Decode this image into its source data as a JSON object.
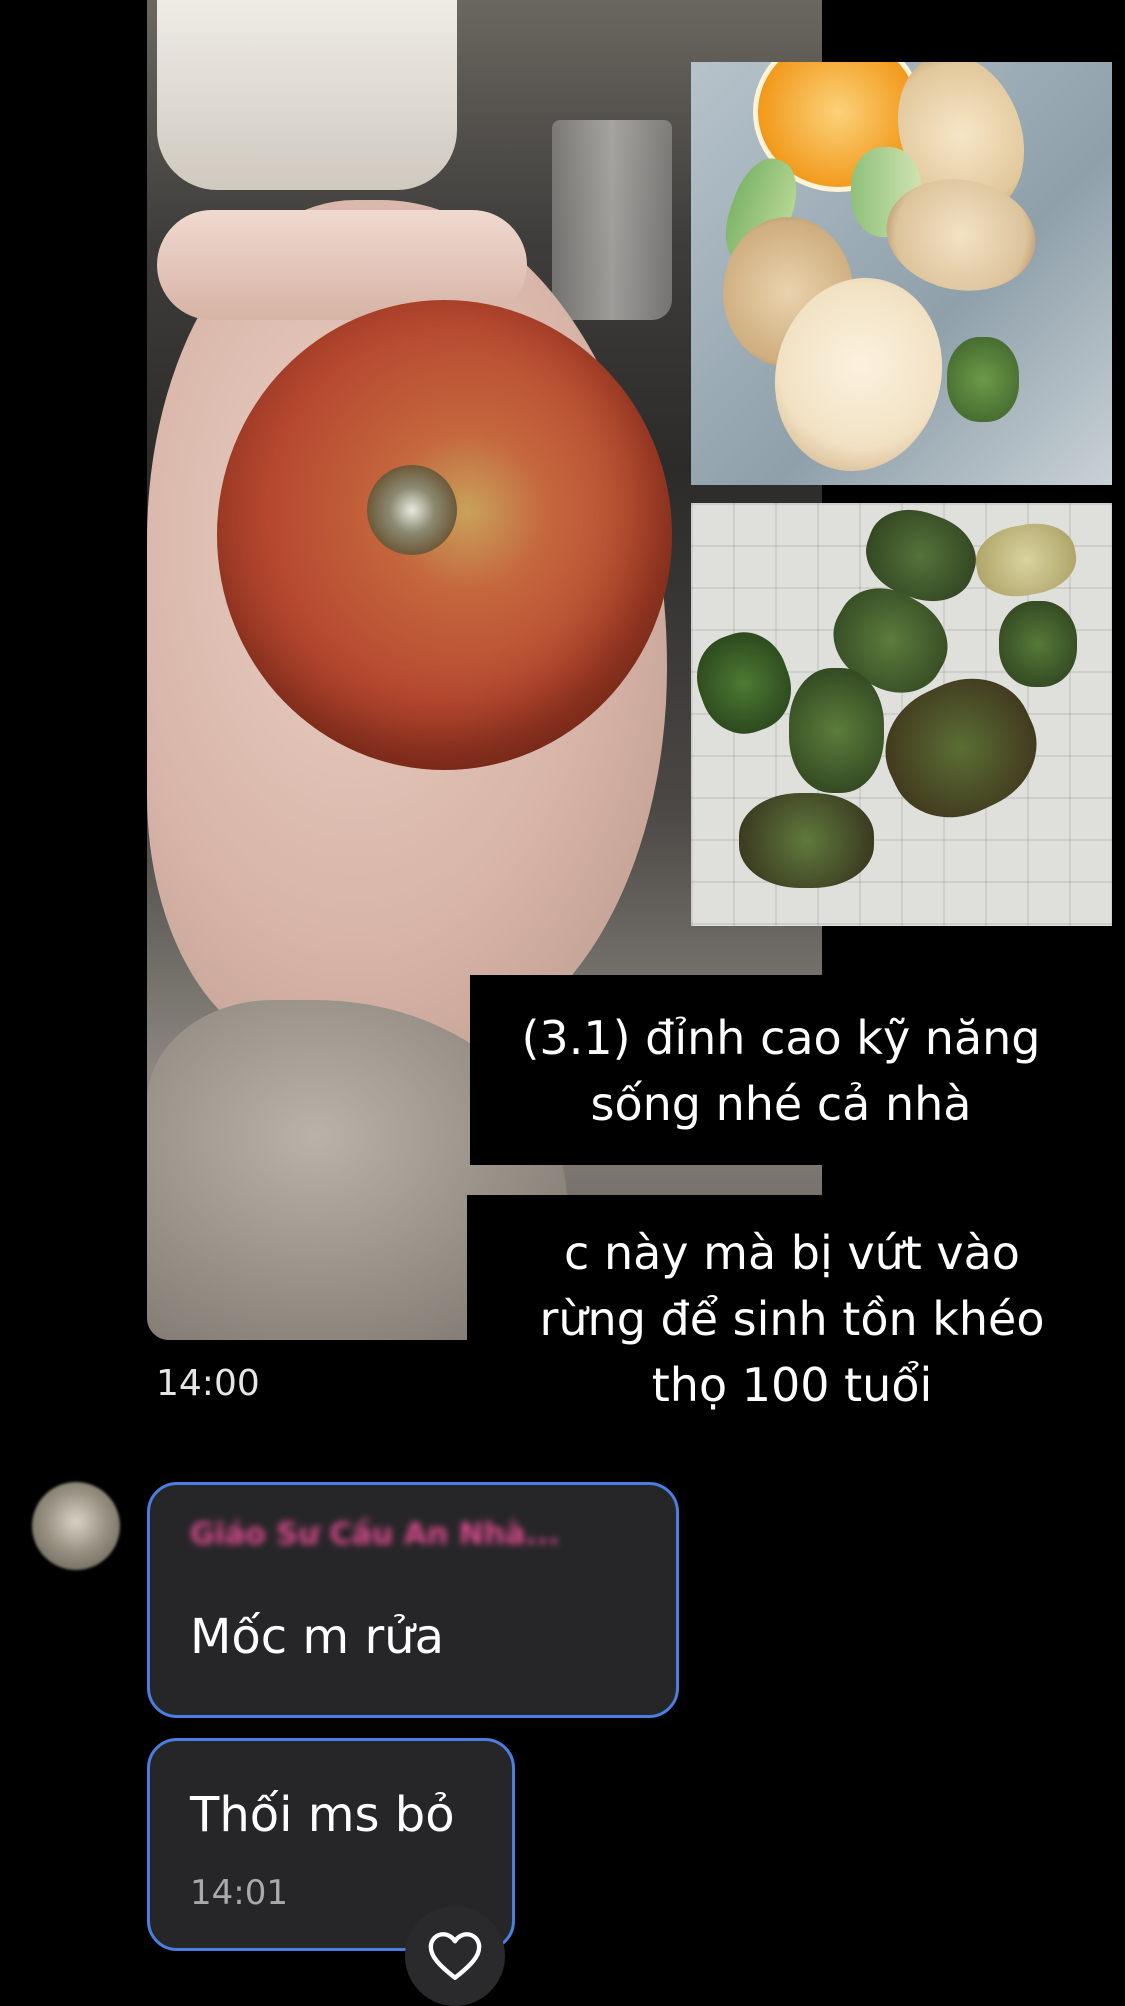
{
  "post": {
    "caption_1": "(3.1) đỉnh cao kỹ năng\nsống nhé cả nhà",
    "caption_2": "c này mà bị vứt vào\nrừng để sinh tồn khéo\nthọ 100 tuổi",
    "timestamp": "14:00"
  },
  "replies": [
    {
      "sender": "Giáo Sư Cầu An Nhà...",
      "text": "Mốc m rửa"
    },
    {
      "text": "Thối ms bỏ",
      "timestamp": "14:01"
    }
  ],
  "icons": {
    "reaction": "heart-icon"
  },
  "colors": {
    "background": "#000000",
    "bubble": "#262628",
    "bubble_border": "#4a7fe0",
    "sender_name": "#d84a8c"
  }
}
